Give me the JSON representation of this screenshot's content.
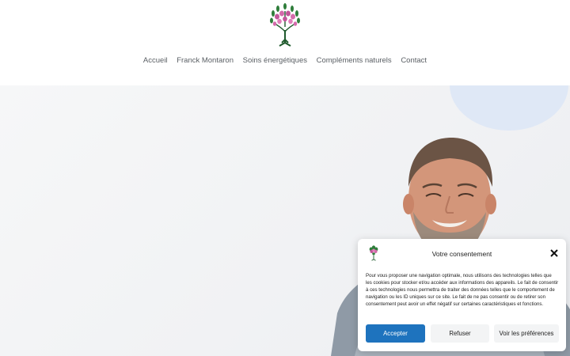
{
  "header": {
    "logo_icon": "tree-logo-icon",
    "nav": [
      {
        "label": "Accueil"
      },
      {
        "label": "Franck Montaron"
      },
      {
        "label": "Soins énergétiques"
      },
      {
        "label": "Compléments naturels"
      },
      {
        "label": "Contact"
      }
    ]
  },
  "hero": {
    "image": "portrait-photo",
    "background_color": "#f3f4f6",
    "accent_circle_color": "#dfe8f6"
  },
  "consent": {
    "title": "Votre consentement",
    "close_icon": "close-icon",
    "text": "Pour vous proposer une navigation optimale, nous utilisons des technologies telles que les cookies pour stocker et/ou accéder aux informations des appareils. Le fait de consentir à ces technologies nous permettra de traiter des données telles que le comportement de navigation ou les ID uniques sur ce site. Le fait de ne pas consentir ou de retirer son consentement peut avoir un effet négatif sur certaines caractéristiques et fonctions.",
    "buttons": {
      "accept": "Accepter",
      "refuse": "Refuser",
      "preferences": "Voir les préférences"
    },
    "accent_color": "#1e73be"
  }
}
